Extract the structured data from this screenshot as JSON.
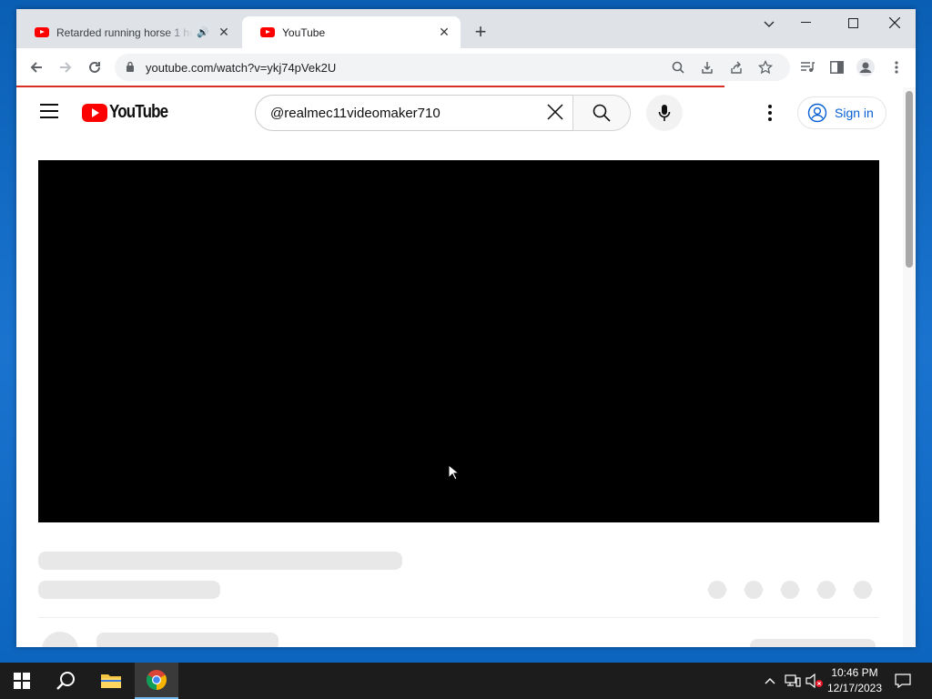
{
  "browser": {
    "tabs": [
      {
        "title": "Retarded running horse 1 ho",
        "active": false,
        "audio": true
      },
      {
        "title": "YouTube",
        "active": true,
        "audio": false
      }
    ],
    "url": "youtube.com/watch?v=ykj74pVek2U"
  },
  "youtube": {
    "logo_text": "YouTube",
    "search_query": "@realmec11videomaker710",
    "signin_label": "Sign in"
  },
  "taskbar": {
    "time": "10:46 PM",
    "date": "12/17/2023"
  },
  "colors": {
    "brand_red": "#ff0000",
    "link_blue": "#065fd4",
    "loading_bar": "#d93025",
    "taskbar": "#1c1c1c"
  }
}
